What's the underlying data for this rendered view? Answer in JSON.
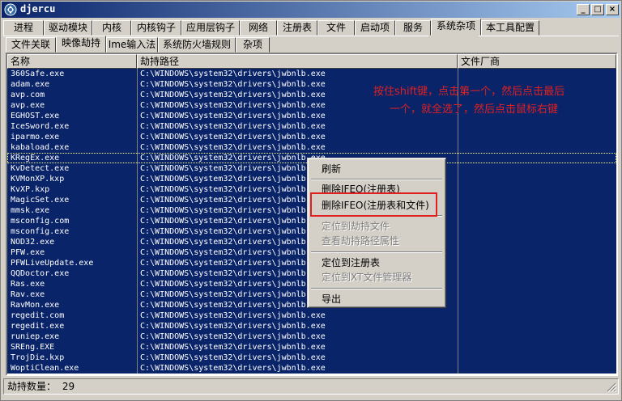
{
  "window": {
    "title": "djercu",
    "minimize_label": "_",
    "maximize_label": "□",
    "close_label": "×"
  },
  "main_tabs": [
    {
      "label": "进程"
    },
    {
      "label": "驱动模块"
    },
    {
      "label": "内核"
    },
    {
      "label": "内核钩子"
    },
    {
      "label": "应用层钩子"
    },
    {
      "label": "网络"
    },
    {
      "label": "注册表"
    },
    {
      "label": "文件"
    },
    {
      "label": "启动项"
    },
    {
      "label": "服务"
    },
    {
      "label": "系统杂项"
    },
    {
      "label": "本工具配置"
    }
  ],
  "active_main_tab": "系统杂项",
  "sub_tabs": [
    {
      "label": "文件关联"
    },
    {
      "label": "映像劫持"
    },
    {
      "label": "Ime输入法"
    },
    {
      "label": "系统防火墙规则"
    },
    {
      "label": "杂项"
    }
  ],
  "active_sub_tab": "映像劫持",
  "table": {
    "columns": [
      "名称",
      "劫持路径",
      "文件厂商"
    ],
    "path": "C:\\WINDOWS\\system32\\drivers\\jwbnlb.exe",
    "rows": [
      {
        "name": "360Safe.exe",
        "path": "C:\\WINDOWS\\system32\\drivers\\jwbnlb.exe",
        "vendor": ""
      },
      {
        "name": "adam.exe",
        "path": "C:\\WINDOWS\\system32\\drivers\\jwbnlb.exe",
        "vendor": ""
      },
      {
        "name": "avp.com",
        "path": "C:\\WINDOWS\\system32\\drivers\\jwbnlb.exe",
        "vendor": ""
      },
      {
        "name": "avp.exe",
        "path": "C:\\WINDOWS\\system32\\drivers\\jwbnlb.exe",
        "vendor": ""
      },
      {
        "name": "EGHOST.exe",
        "path": "C:\\WINDOWS\\system32\\drivers\\jwbnlb.exe",
        "vendor": ""
      },
      {
        "name": "IceSword.exe",
        "path": "C:\\WINDOWS\\system32\\drivers\\jwbnlb.exe",
        "vendor": ""
      },
      {
        "name": "iparmo.exe",
        "path": "C:\\WINDOWS\\system32\\drivers\\jwbnlb.exe",
        "vendor": ""
      },
      {
        "name": "kabaload.exe",
        "path": "C:\\WINDOWS\\system32\\drivers\\jwbnlb.exe",
        "vendor": ""
      },
      {
        "name": "KRegEx.exe",
        "path": "C:\\WINDOWS\\system32\\drivers\\jwbnlb.exe",
        "vendor": ""
      },
      {
        "name": "KvDetect.exe",
        "path": "C:\\WINDOWS\\system32\\drivers\\jwbnlb.exe",
        "vendor": ""
      },
      {
        "name": "KVMonXP.kxp",
        "path": "C:\\WINDOWS\\system32\\drivers\\jwbnlb.exe",
        "vendor": ""
      },
      {
        "name": "KvXP.kxp",
        "path": "C:\\WINDOWS\\system32\\drivers\\jwbnlb.exe",
        "vendor": ""
      },
      {
        "name": "MagicSet.exe",
        "path": "C:\\WINDOWS\\system32\\drivers\\jwbnlb.exe",
        "vendor": ""
      },
      {
        "name": "mmsk.exe",
        "path": "C:\\WINDOWS\\system32\\drivers\\jwbnlb.exe",
        "vendor": ""
      },
      {
        "name": "msconfig.com",
        "path": "C:\\WINDOWS\\system32\\drivers\\jwbnlb.exe",
        "vendor": ""
      },
      {
        "name": "msconfig.exe",
        "path": "C:\\WINDOWS\\system32\\drivers\\jwbnlb.exe",
        "vendor": ""
      },
      {
        "name": "NOD32.exe",
        "path": "C:\\WINDOWS\\system32\\drivers\\jwbnlb.exe",
        "vendor": ""
      },
      {
        "name": "PFW.exe",
        "path": "C:\\WINDOWS\\system32\\drivers\\jwbnlb.exe",
        "vendor": ""
      },
      {
        "name": "PFWLiveUpdate.exe",
        "path": "C:\\WINDOWS\\system32\\drivers\\jwbnlb.exe",
        "vendor": ""
      },
      {
        "name": "QQDoctor.exe",
        "path": "C:\\WINDOWS\\system32\\drivers\\jwbnlb.exe",
        "vendor": ""
      },
      {
        "name": "Ras.exe",
        "path": "C:\\WINDOWS\\system32\\drivers\\jwbnlb.exe",
        "vendor": ""
      },
      {
        "name": "Rav.exe",
        "path": "C:\\WINDOWS\\system32\\drivers\\jwbnlb.exe",
        "vendor": ""
      },
      {
        "name": "RavMon.exe",
        "path": "C:\\WINDOWS\\system32\\drivers\\jwbnlb.exe",
        "vendor": ""
      },
      {
        "name": "regedit.com",
        "path": "C:\\WINDOWS\\system32\\drivers\\jwbnlb.exe",
        "vendor": ""
      },
      {
        "name": "regedit.exe",
        "path": "C:\\WINDOWS\\system32\\drivers\\jwbnlb.exe",
        "vendor": ""
      },
      {
        "name": "runiep.exe",
        "path": "C:\\WINDOWS\\system32\\drivers\\jwbnlb.exe",
        "vendor": ""
      },
      {
        "name": "SREng.EXE",
        "path": "C:\\WINDOWS\\system32\\drivers\\jwbnlb.exe",
        "vendor": ""
      },
      {
        "name": "TrojDie.kxp",
        "path": "C:\\WINDOWS\\system32\\drivers\\jwbnlb.exe",
        "vendor": ""
      },
      {
        "name": "WoptiClean.exe",
        "path": "C:\\WINDOWS\\system32\\drivers\\jwbnlb.exe",
        "vendor": ""
      }
    ],
    "focused_row": "KRegEx.exe"
  },
  "annotation": {
    "line1": "按住shift键，点击第一个，然后点击最后",
    "line2": "一个，就全选了，然后点击鼠标右键"
  },
  "context_menu": {
    "refresh": "刷新",
    "delete_ifeo_reg": "删除IFEO(注册表)",
    "delete_ifeo_reg_file": "删除IFEO(注册表和文件)",
    "locate_hijack_file": "定位到劫持文件",
    "view_hijack_path_props": "查看劫持路径属性",
    "locate_registry": "定位到注册表",
    "locate_xt_file_manager": "定位到XT文件管理器",
    "export": "导出"
  },
  "status": {
    "label": "劫持数量：",
    "count": "29"
  },
  "colors": {
    "selection": "#0a246a",
    "annotation": "#e02020",
    "face": "#d4d0c8"
  }
}
